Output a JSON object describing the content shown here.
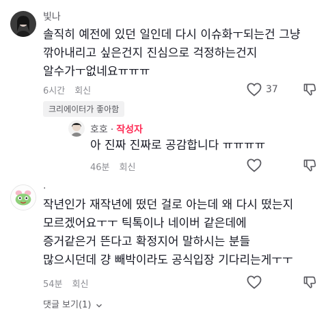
{
  "comments": [
    {
      "username": "빛나",
      "text": "솔직히 예전에 있던 일인데 다시 이슈화ㅜ되는건 그냥\n깎아내리고 싶은건지 진심으로 걱정하는건지\n알수가ㅜ없네요ㅠㅠㅠ",
      "time": "6시간",
      "reply_label": "회신",
      "likes": "37",
      "badge": "크리에이터가 좋아함"
    },
    {
      "username": ".",
      "text": "작년인가 재작년에 떴던 걸로 아는데 왜 다시 떴는지\n모르겠어요ㅜㅜ 틱톡이나 네이버 같은데에\n증거같은거 뜬다고 확정지어 말하시는 분들\n많으시던데 걍 빼박이라도 공식입장 기다리는게ㅜㅜ",
      "time": "54분",
      "reply_label": "회신",
      "likes": ""
    }
  ],
  "reply": {
    "username": "호호",
    "separator": "·",
    "author_tag": "작성자",
    "text": "아 진짜 진짜로 공감합니다 ㅠㅠㅠㅠ",
    "time": "46분",
    "reply_label": "회신"
  },
  "view_replies": "댓글 보기(1)",
  "icons": {
    "like": "heart-icon",
    "dislike": "thumbs-down-icon",
    "expand": "chevron-down-icon"
  },
  "colors": {
    "author_tag": "#fe2c55",
    "meta": "#8a8b91"
  }
}
